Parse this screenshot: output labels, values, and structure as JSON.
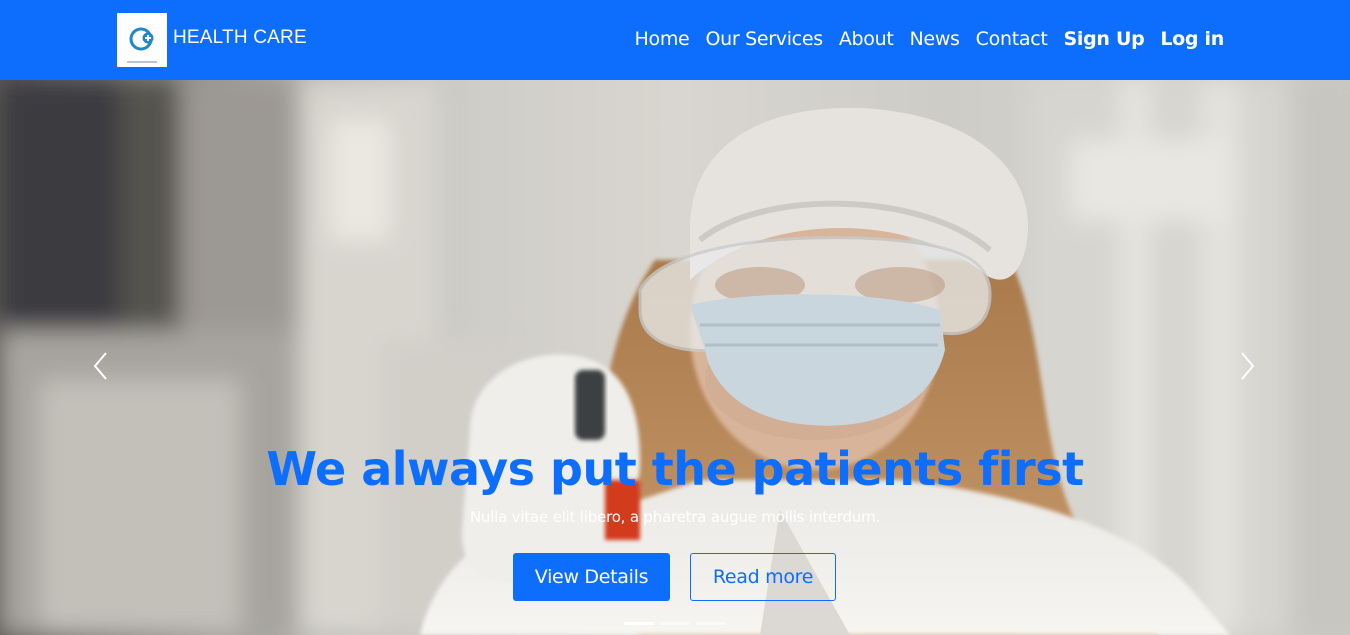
{
  "brand": {
    "name": "HEALTH CARE",
    "logo_icon": "medical-cross-logo-icon"
  },
  "nav": {
    "items": [
      {
        "label": "Home",
        "bold": false
      },
      {
        "label": "Our Services",
        "bold": false
      },
      {
        "label": "About",
        "bold": false
      },
      {
        "label": "News",
        "bold": false
      },
      {
        "label": "Contact",
        "bold": false
      },
      {
        "label": "Sign Up",
        "bold": true
      },
      {
        "label": "Log in",
        "bold": true
      }
    ]
  },
  "hero": {
    "title": "We always put the patients first",
    "subtitle": "Nulla vitae elit libero, a pharetra augue mollis interdum.",
    "primary_button": "View Details",
    "secondary_button": "Read more",
    "prev_icon": "chevron-left-icon",
    "next_icon": "chevron-right-icon",
    "slides_total": 3,
    "active_slide": 1
  },
  "colors": {
    "primary": "#0d6efd",
    "white": "#ffffff"
  }
}
